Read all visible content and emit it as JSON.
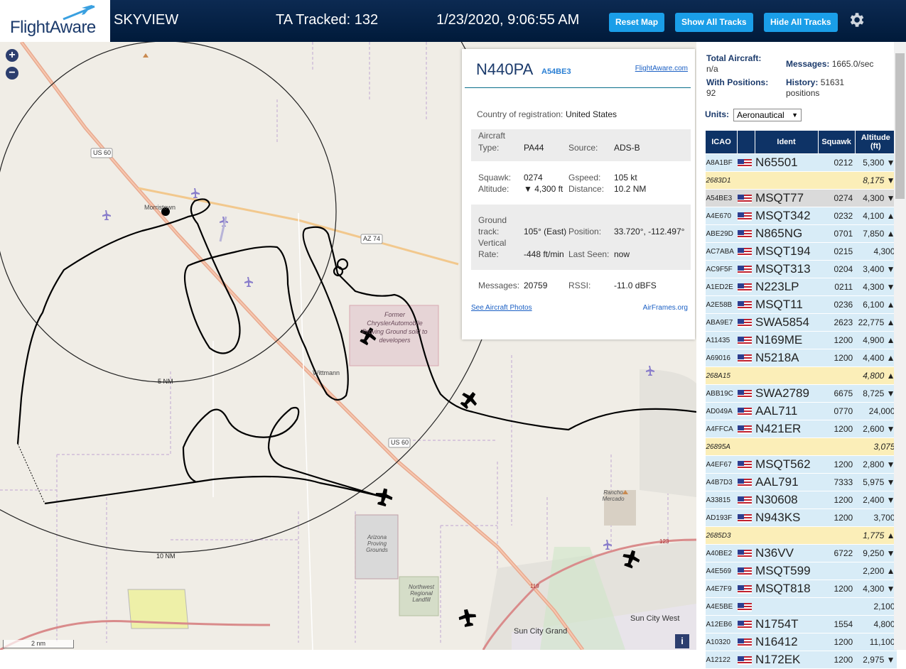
{
  "header": {
    "logo_text": "FlightAware",
    "app_title": "SKYVIEW",
    "tracked": "TA Tracked: 132",
    "datetime": "1/23/2020, 9:06:55 AM",
    "reset_map": "Reset Map",
    "show_all_tracks": "Show All Tracks",
    "hide_all_tracks": "Hide All Tracks"
  },
  "map": {
    "labels": {
      "morristown": "Morristown",
      "us60_top": "US 60",
      "az74": "AZ 74",
      "us60_mid": "US 60",
      "wittmann": "Wittmann",
      "ring5": "5 NM",
      "ring10": "10 NM",
      "chrysler": "Former ChryslerAutomobile Proving Ground sold to developers",
      "rancho": "Rancho Mercado",
      "arizona_pg": "Arizona Proving Grounds",
      "landfill": "Northwest Regional Landfill",
      "sun_city_grand": "Sun City Grand",
      "sun_city_west": "Sun City West",
      "r119": "119",
      "r123": "123",
      "scale": "2 nm"
    },
    "zoom_in": "+",
    "zoom_out": "−",
    "info_btn": "i"
  },
  "aircraft_info": {
    "registration": "N440PA",
    "hex": "A54BE3",
    "flightaware_link": "FlightAware.com",
    "country_label": "Country of registration:",
    "country": "United States",
    "aircraft_type_label_1": "Aircraft",
    "aircraft_type_label_2": "Type:",
    "aircraft_type": "PA44",
    "source_label": "Source:",
    "source": "ADS-B",
    "squawk_label": "Squawk:",
    "squawk": "0274",
    "altitude_label": "Altitude:",
    "altitude": "▼ 4,300 ft",
    "gspeed_label": "Gspeed:",
    "gspeed": "105 kt",
    "distance_label": "Distance:",
    "distance": "10.2 NM",
    "ground_label_1": "Ground",
    "ground_label_2": "track:",
    "ground_track": "105° (East)",
    "position_label": "Position:",
    "position": "33.720°, -112.497°",
    "vrate_label_1": "Vertical",
    "vrate_label_2": "Rate:",
    "vertical_rate": "-448 ft/min",
    "last_seen_label": "Last Seen:",
    "last_seen": "now",
    "messages_label": "Messages:",
    "messages": "20759",
    "rssi_label": "RSSI:",
    "rssi": "-11.0 dBFS",
    "photos_link": "See Aircraft Photos",
    "airframes_link": "AirFrames.org"
  },
  "stats": {
    "total_aircraft_label": "Total Aircraft:",
    "total_aircraft": "n/a",
    "messages_label": "Messages:",
    "messages": "1665.0/sec",
    "with_positions_label": "With Positions:",
    "with_positions": "92",
    "history_label": "History:",
    "history": "51631 positions",
    "units_label": "Units:",
    "units_value": "Aeronautical"
  },
  "table": {
    "headers": [
      "ICAO",
      "",
      "Ident",
      "Squawk",
      "Altitude (ft)"
    ],
    "rows": [
      {
        "icao": "A8A1BF",
        "flag": true,
        "ident": "N65501",
        "squawk": "0212",
        "alt": "5,300 ▼",
        "style": "r"
      },
      {
        "icao": "2683D1",
        "flag": false,
        "ident": "",
        "squawk": "",
        "alt": "8,175 ▼",
        "style": "y"
      },
      {
        "icao": "A54BE3",
        "flag": true,
        "ident": "MSQT77",
        "squawk": "0274",
        "alt": "4,300 ▼",
        "style": "s"
      },
      {
        "icao": "A4E670",
        "flag": true,
        "ident": "MSQT342",
        "squawk": "0232",
        "alt": "4,100 ▲",
        "style": "r"
      },
      {
        "icao": "ABE29D",
        "flag": true,
        "ident": "N865NG",
        "squawk": "0701",
        "alt": "7,850 ▲",
        "style": "r"
      },
      {
        "icao": "AC7ABA",
        "flag": true,
        "ident": "MSQT194",
        "squawk": "0215",
        "alt": "4,300",
        "style": "r"
      },
      {
        "icao": "AC9F5F",
        "flag": true,
        "ident": "MSQT313",
        "squawk": "0204",
        "alt": "3,400 ▼",
        "style": "r"
      },
      {
        "icao": "A1ED2E",
        "flag": true,
        "ident": "N223LP",
        "squawk": "0211",
        "alt": "4,300 ▼",
        "style": "r"
      },
      {
        "icao": "A2E58B",
        "flag": true,
        "ident": "MSQT11",
        "squawk": "0236",
        "alt": "6,100 ▲",
        "style": "r"
      },
      {
        "icao": "ABA9E7",
        "flag": true,
        "ident": "SWA5854",
        "squawk": "2623",
        "alt": "22,775 ▲",
        "style": "r"
      },
      {
        "icao": "A11435",
        "flag": true,
        "ident": "N169ME",
        "squawk": "1200",
        "alt": "4,900 ▲",
        "style": "r"
      },
      {
        "icao": "A69016",
        "flag": true,
        "ident": "N5218A",
        "squawk": "1200",
        "alt": "4,400 ▲",
        "style": "r"
      },
      {
        "icao": "268A15",
        "flag": false,
        "ident": "",
        "squawk": "",
        "alt": "4,800 ▲",
        "style": "y"
      },
      {
        "icao": "ABB19C",
        "flag": true,
        "ident": "SWA2789",
        "squawk": "6675",
        "alt": "8,725 ▼",
        "style": "r"
      },
      {
        "icao": "AD049A",
        "flag": true,
        "ident": "AAL711",
        "squawk": "0770",
        "alt": "24,000",
        "style": "r"
      },
      {
        "icao": "A4FFCA",
        "flag": true,
        "ident": "N421ER",
        "squawk": "1200",
        "alt": "2,600 ▼",
        "style": "r"
      },
      {
        "icao": "26895A",
        "flag": false,
        "ident": "",
        "squawk": "",
        "alt": "3,075",
        "style": "y"
      },
      {
        "icao": "A4EF67",
        "flag": true,
        "ident": "MSQT562",
        "squawk": "1200",
        "alt": "2,800 ▼",
        "style": "r"
      },
      {
        "icao": "A4B7D3",
        "flag": true,
        "ident": "AAL791",
        "squawk": "7333",
        "alt": "5,975 ▼",
        "style": "r"
      },
      {
        "icao": "A33815",
        "flag": true,
        "ident": "N30608",
        "squawk": "1200",
        "alt": "2,400 ▼",
        "style": "r"
      },
      {
        "icao": "AD193F",
        "flag": true,
        "ident": "N943KS",
        "squawk": "1200",
        "alt": "3,700",
        "style": "r"
      },
      {
        "icao": "2685D3",
        "flag": false,
        "ident": "",
        "squawk": "",
        "alt": "1,775 ▲",
        "style": "y"
      },
      {
        "icao": "A40BE2",
        "flag": true,
        "ident": "N36VV",
        "squawk": "6722",
        "alt": "9,250 ▼",
        "style": "r"
      },
      {
        "icao": "A4E569",
        "flag": true,
        "ident": "MSQT599",
        "squawk": "",
        "alt": "2,200 ▲",
        "style": "r"
      },
      {
        "icao": "A4E7F9",
        "flag": true,
        "ident": "MSQT818",
        "squawk": "1200",
        "alt": "4,300 ▼",
        "style": "r"
      },
      {
        "icao": "A4E5BE",
        "flag": true,
        "ident": "",
        "squawk": "",
        "alt": "2,100",
        "style": "r"
      },
      {
        "icao": "A12EB6",
        "flag": true,
        "ident": "N1754T",
        "squawk": "1554",
        "alt": "4,800",
        "style": "r"
      },
      {
        "icao": "A10320",
        "flag": true,
        "ident": "N16412",
        "squawk": "1200",
        "alt": "11,100",
        "style": "r"
      },
      {
        "icao": "A12122",
        "flag": true,
        "ident": "N172EK",
        "squawk": "1200",
        "alt": "2,975 ▼",
        "style": "r"
      }
    ]
  },
  "colors": {
    "header_bg": "#0c2a52",
    "button_bg": "#1a9ee8",
    "table_header": "#0e3366",
    "row_bg": "#d8ecf7",
    "row_no_pos": "#fbeeb8",
    "row_selected": "#dadada"
  }
}
